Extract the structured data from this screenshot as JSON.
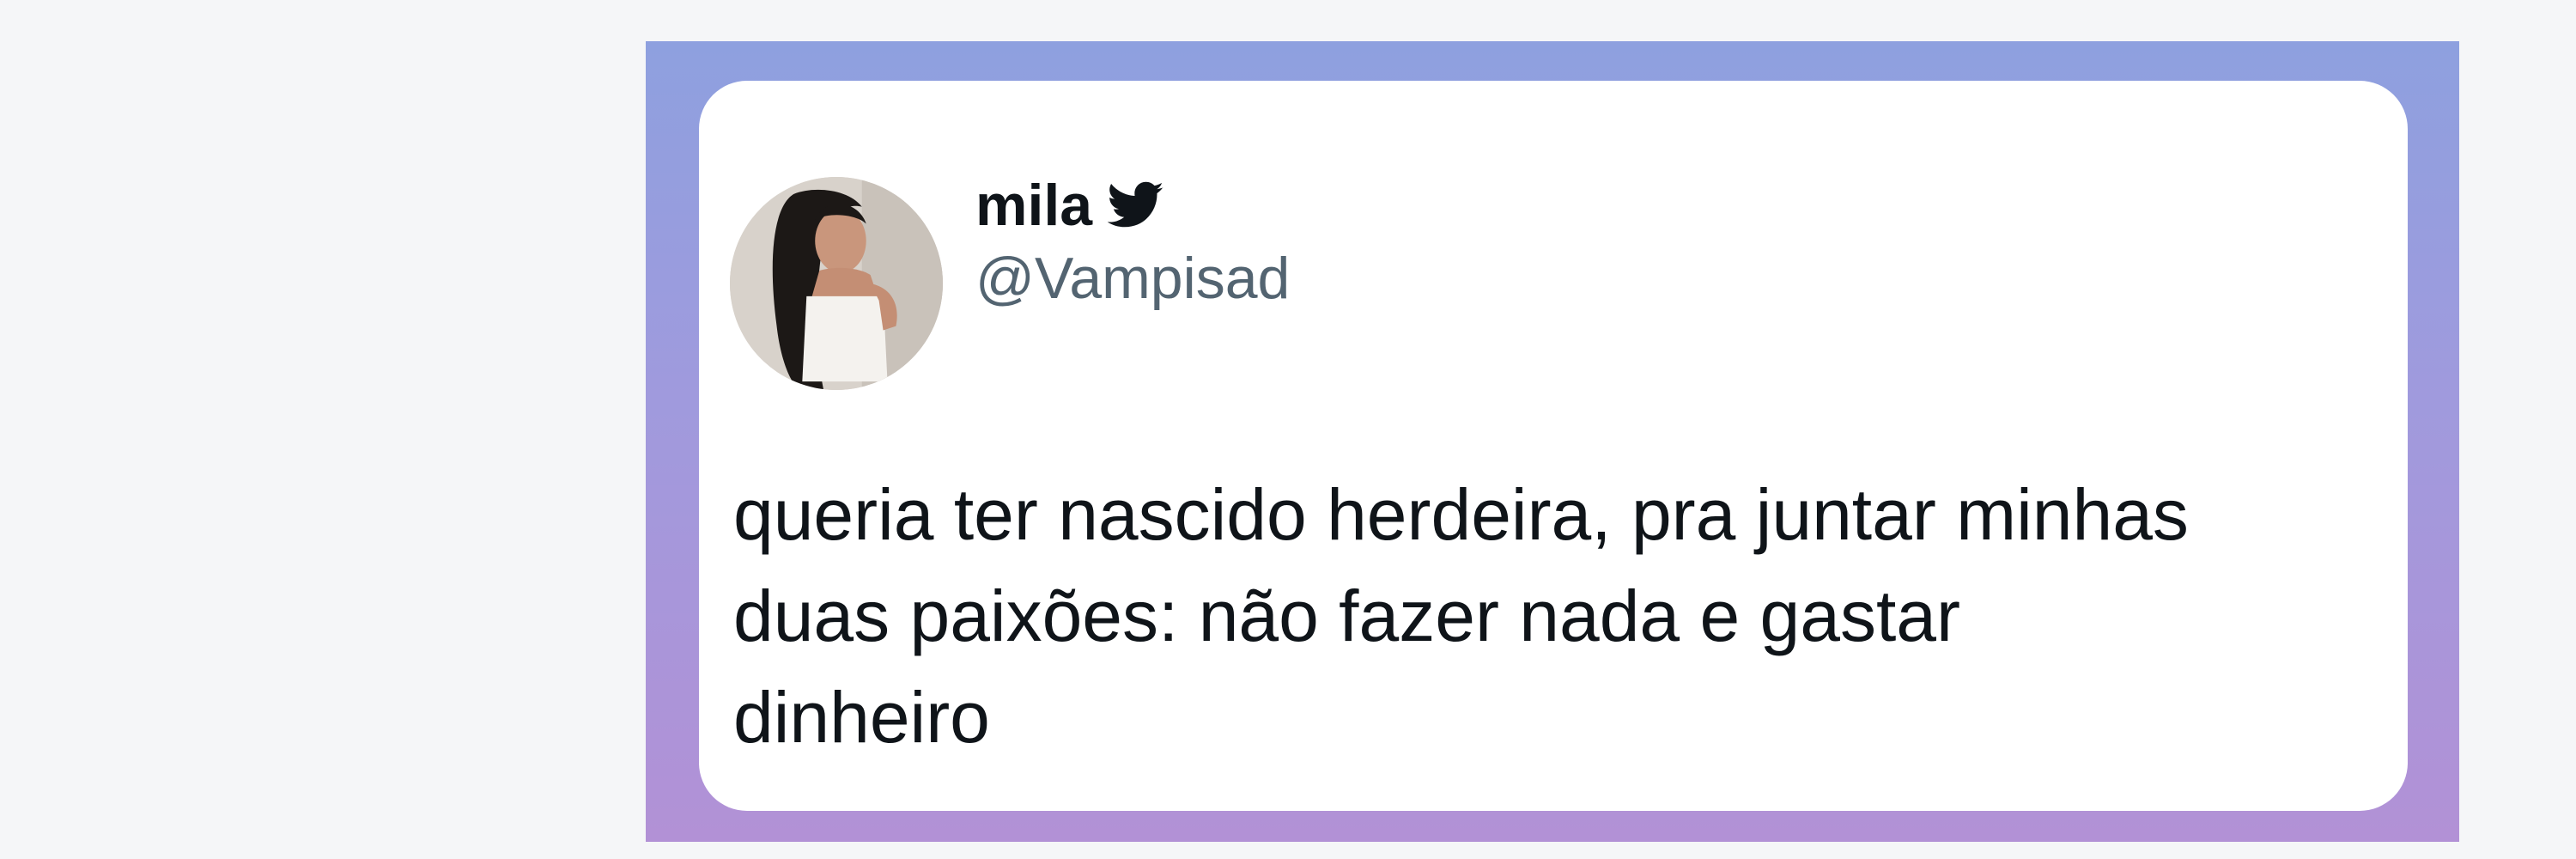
{
  "tweet": {
    "author_name": "mila",
    "author_handle": "@Vampisad",
    "verified_icon": "twitter-bird-icon",
    "avatar_icon": "profile-photo",
    "text_lines": [
      "queria ter nascido herdeira, pra juntar minhas",
      "duas paixões: não fazer nada e gastar",
      "dinheiro"
    ]
  },
  "colors": {
    "page_background": "#f5f6f8",
    "frame_gradient_top": "#8ea0df",
    "frame_gradient_bottom": "#b291d6",
    "card_background": "#ffffff",
    "name_color": "#0f1419",
    "handle_color": "#536471",
    "text_color": "#0f1419"
  }
}
